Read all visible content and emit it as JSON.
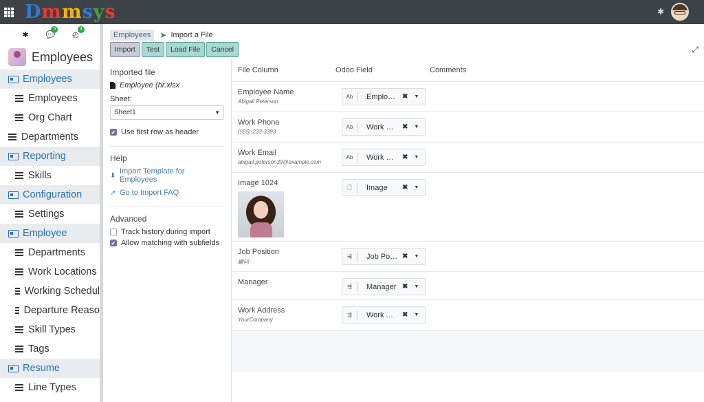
{
  "brand": {
    "name_letters": [
      "D",
      "m",
      "m",
      "s",
      "y",
      "s"
    ]
  },
  "topbar": {
    "apps_icon": "grid-icon",
    "debug_icon": "bug-icon",
    "avatar_icon": "user-avatar"
  },
  "sidebar": {
    "icons": [
      {
        "icon": "bug-icon",
        "badge": ""
      },
      {
        "icon": "chat-icon",
        "badge": "5"
      },
      {
        "icon": "clock-icon",
        "badge": "4"
      }
    ],
    "app_title": "Employees",
    "items": [
      {
        "label": "Employees",
        "type": "section"
      },
      {
        "label": "Employees",
        "type": "child"
      },
      {
        "label": "Org Chart",
        "type": "child"
      },
      {
        "label": "Departments",
        "type": "top"
      },
      {
        "label": "Reporting",
        "type": "section"
      },
      {
        "label": "Skills",
        "type": "child"
      },
      {
        "label": "Configuration",
        "type": "section"
      },
      {
        "label": "Settings",
        "type": "child"
      },
      {
        "label": "Employee",
        "type": "section"
      },
      {
        "label": "Departments",
        "type": "child"
      },
      {
        "label": "Work Locations",
        "type": "child"
      },
      {
        "label": "Working Schedul",
        "type": "child"
      },
      {
        "label": "Departure Reaso",
        "type": "child"
      },
      {
        "label": "Skill Types",
        "type": "child"
      },
      {
        "label": "Tags",
        "type": "child"
      },
      {
        "label": "Resume",
        "type": "section"
      },
      {
        "label": "Line Types",
        "type": "child"
      }
    ]
  },
  "breadcrumb": {
    "parent": "Employees",
    "current": "Import a File"
  },
  "toolbar": {
    "import": "Import",
    "test": "Test",
    "load_file": "Load File",
    "cancel": "Cancel"
  },
  "left_panel": {
    "imported_file_title": "Imported file",
    "file_name": "Employee (hr.xlsx",
    "sheet_label": "Sheet:",
    "sheet_value": "Sheet1",
    "first_row_header": {
      "label": "Use first row as header",
      "checked": true
    },
    "help_title": "Help",
    "template_link": "Import Template for Employees",
    "faq_link": "Go to Import FAQ",
    "advanced_title": "Advanced",
    "track_history": {
      "label": "Track history during import",
      "checked": false
    },
    "allow_matching": {
      "label": "Allow matching with subfields",
      "checked": true
    }
  },
  "mapping": {
    "headers": {
      "file_column": "File Column",
      "odoo_field": "Odoo Field",
      "comments": "Comments"
    },
    "rows": [
      {
        "name": "Employee Name",
        "sample": "Abigail Peterson",
        "field": "Employee Name",
        "type_icon": "Ab"
      },
      {
        "name": "Work Phone",
        "sample": "(555)-233-3393",
        "field": "Work Phone",
        "type_icon": "Ab"
      },
      {
        "name": "Work Email",
        "sample": "abigail.peterson39@example.com",
        "field": "Work Email",
        "type_icon": "Ab"
      },
      {
        "name": "Image 1024",
        "sample": "",
        "field": "Image",
        "type_icon": "file-icon",
        "has_image": true
      },
      {
        "name": "Job Position",
        "sample": "顧问",
        "field": "Job Position",
        "type_icon": "relation-icon"
      },
      {
        "name": "Manager",
        "sample": "",
        "field": "Manager",
        "type_icon": "relation-icon"
      },
      {
        "name": "Work Address",
        "sample": "YourCompany",
        "field": "Work Address",
        "type_icon": "relation-icon"
      }
    ]
  }
}
